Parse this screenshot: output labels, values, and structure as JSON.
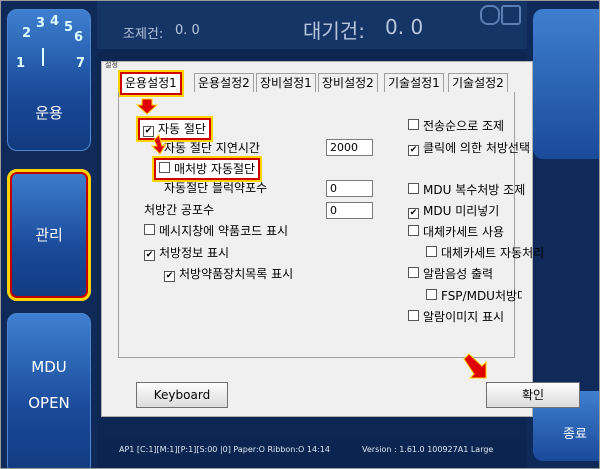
{
  "top": {
    "queue_label": "조제건:",
    "queue_value": "0.  0",
    "wait_label": "대기건:",
    "wait_value": "0.  0"
  },
  "left": {
    "dial_numbers": [
      "1",
      "2",
      "3",
      "4",
      "5",
      "6",
      "7"
    ],
    "dial_left": "1",
    "dial_right": "7",
    "btn_run": "운용",
    "btn_manage": "관리",
    "btn_mdu_1": "MDU",
    "btn_mdu_2": "OPEN"
  },
  "right": {
    "end_label": "종료"
  },
  "dialog": {
    "title": "설정",
    "tabs": [
      "운용설정1",
      "운용설정2",
      "장비설정1",
      "장비설정2",
      "기술설정1",
      "기술설정2"
    ],
    "left_col": {
      "auto_stop": "자동 절단",
      "auto_stop_delay_label": "자동 절단 지연시간",
      "auto_stop_delay_value": "2000",
      "per_rx_auto_stop": "매처방 자동절단",
      "auto_stop_block_label": "자동절단 블럭약포수",
      "auto_stop_block_value": "0",
      "between_rx_label": "처방간 공포수",
      "between_rx_value": "0",
      "show_code": "메시지창에 약품코드 표시",
      "show_rx_info": "처방정보 표시",
      "show_rx_device_list": "처방약품장치목록 표시"
    },
    "right_col": {
      "by_send_order": "전송순으로 조제",
      "click_select": "클릭에 의한 처방선택",
      "mdu_multi": "MDU 복수처방 조제",
      "mdu_preload": "MDU 미리넣기",
      "alt_cassette": "대체카세트 사용",
      "alt_cassette_auto": "대체카세트 자동처리",
      "alarm_voice": "알람음성 출력",
      "fsp_voice": "FSP/MDU처방대기중음성 출",
      "alarm_image": "알람이미지 표시"
    },
    "keyboard_btn": "Keyboard",
    "ok_btn": "확인"
  },
  "status": {
    "left": "AP1 [C:1][M:1][P:1][S:00 |0] Paper:O Ribbon:O 14:14",
    "right": "Version : 1.61.0 100927A1 Large"
  },
  "colors": {
    "highlight": "#ffd400",
    "annotation_red": "#d00000",
    "panel_blue": "#1a4a99"
  }
}
